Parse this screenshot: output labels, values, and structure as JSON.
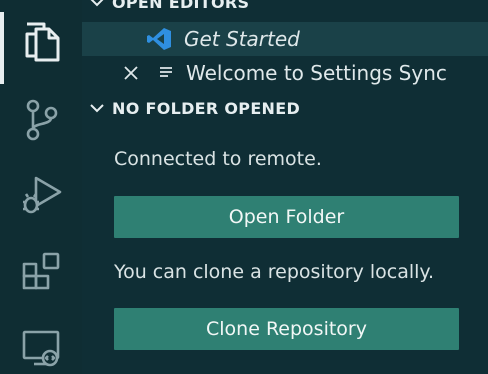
{
  "activity_bar": {
    "items": [
      {
        "name": "explorer",
        "icon": "files-icon",
        "active": true
      },
      {
        "name": "source-control",
        "icon": "source-control-icon"
      },
      {
        "name": "run-and-debug",
        "icon": "run-debug-icon"
      },
      {
        "name": "extensions",
        "icon": "extensions-icon"
      },
      {
        "name": "remote-explorer",
        "icon": "remote-explorer-icon"
      }
    ]
  },
  "open_editors": {
    "title": "OPEN EDITORS",
    "items": [
      {
        "label": "Get Started",
        "icon": "vscode-logo-icon",
        "italic": true
      },
      {
        "label": "Welcome to Settings Sync",
        "icon": "document-lines-icon",
        "close_glyph": "×"
      }
    ]
  },
  "no_folder": {
    "title": "NO FOLDER OPENED",
    "connected_text": "Connected to remote.",
    "open_folder_label": "Open Folder",
    "clone_text": "You can clone a repository locally.",
    "clone_repo_label": "Clone Repository"
  },
  "colors": {
    "background": "#0f2e35",
    "button": "#2f8073",
    "accent_logo": "#2f8fe0"
  }
}
